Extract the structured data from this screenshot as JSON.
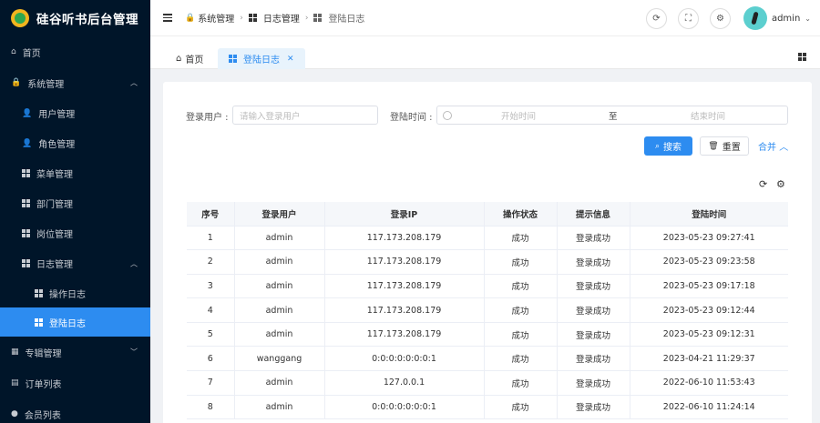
{
  "app": {
    "title": "硅谷听书后台管理"
  },
  "sidebar": {
    "items": [
      {
        "label": "首页",
        "icon": "home-icon",
        "level": 0
      },
      {
        "label": "系统管理",
        "icon": "lock-icon",
        "level": 0,
        "expanded": true
      },
      {
        "label": "用户管理",
        "icon": "user-icon",
        "level": 1
      },
      {
        "label": "角色管理",
        "icon": "user-icon",
        "level": 1
      },
      {
        "label": "菜单管理",
        "icon": "grid-icon",
        "level": 1
      },
      {
        "label": "部门管理",
        "icon": "grid-icon",
        "level": 1
      },
      {
        "label": "岗位管理",
        "icon": "grid-icon",
        "level": 1
      },
      {
        "label": "日志管理",
        "icon": "grid-icon",
        "level": 1,
        "expanded": true
      },
      {
        "label": "操作日志",
        "icon": "grid-icon",
        "level": 2
      },
      {
        "label": "登陆日志",
        "icon": "grid-icon",
        "level": 2,
        "active": true
      },
      {
        "label": "专辑管理",
        "icon": "album-icon",
        "level": 0
      },
      {
        "label": "订单列表",
        "icon": "list-icon",
        "level": 0
      },
      {
        "label": "会员列表",
        "icon": "member-icon",
        "level": 0
      }
    ]
  },
  "header": {
    "breadcrumb": [
      "系统管理",
      "日志管理",
      "登陆日志"
    ],
    "username": "admin"
  },
  "tabs": [
    {
      "label": "首页",
      "active": false
    },
    {
      "label": "登陆日志",
      "active": true
    }
  ],
  "search": {
    "user_label": "登录用户 :",
    "user_placeholder": "请输入登录用户",
    "time_label": "登陆时间 :",
    "start_placeholder": "开始时间",
    "range_separator": "至",
    "end_placeholder": "结束时间",
    "search_btn": "搜索",
    "reset_btn": "重置",
    "collapse_link": "合并"
  },
  "table": {
    "columns": [
      "序号",
      "登录用户",
      "登录IP",
      "操作状态",
      "提示信息",
      "登陆时间"
    ],
    "rows": [
      [
        "1",
        "admin",
        "117.173.208.179",
        "成功",
        "登录成功",
        "2023-05-23 09:27:41"
      ],
      [
        "2",
        "admin",
        "117.173.208.179",
        "成功",
        "登录成功",
        "2023-05-23 09:23:58"
      ],
      [
        "3",
        "admin",
        "117.173.208.179",
        "成功",
        "登录成功",
        "2023-05-23 09:17:18"
      ],
      [
        "4",
        "admin",
        "117.173.208.179",
        "成功",
        "登录成功",
        "2023-05-23 09:12:44"
      ],
      [
        "5",
        "admin",
        "117.173.208.179",
        "成功",
        "登录成功",
        "2023-05-23 09:12:31"
      ],
      [
        "6",
        "wanggang",
        "0:0:0:0:0:0:0:1",
        "成功",
        "登录成功",
        "2023-04-21 11:29:37"
      ],
      [
        "7",
        "admin",
        "127.0.0.1",
        "成功",
        "登录成功",
        "2022-06-10 11:53:43"
      ],
      [
        "8",
        "admin",
        "0:0:0:0:0:0:0:1",
        "成功",
        "登录成功",
        "2022-06-10 11:24:14"
      ]
    ]
  },
  "colors": {
    "sidebar_bg": "#001529",
    "primary": "#2d8cf0"
  }
}
